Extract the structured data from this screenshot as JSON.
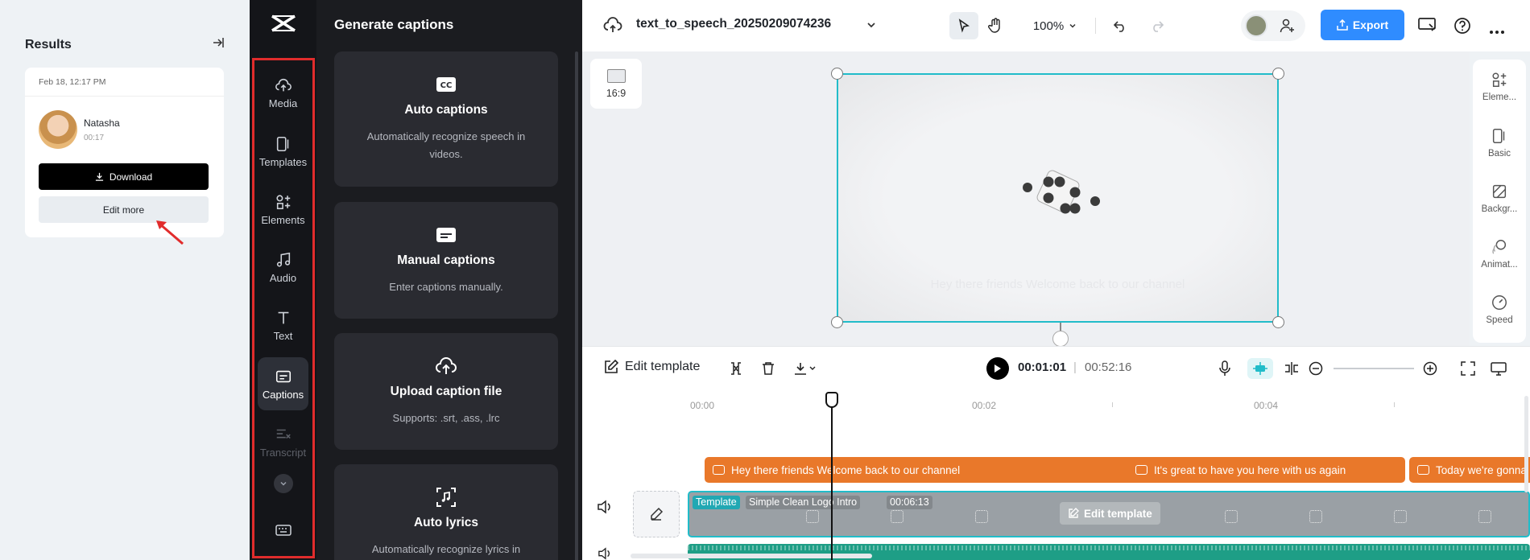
{
  "results": {
    "title": "Results",
    "date": "Feb 18, 12:17 PM",
    "user_name": "Natasha",
    "duration": "00:17",
    "download_label": "Download",
    "edit_more_label": "Edit more"
  },
  "nav": {
    "items": [
      {
        "label": "Media",
        "icon": "cloud-upload-icon"
      },
      {
        "label": "Templates",
        "icon": "templates-icon"
      },
      {
        "label": "Elements",
        "icon": "elements-icon"
      },
      {
        "label": "Audio",
        "icon": "music-note-icon"
      },
      {
        "label": "Text",
        "icon": "text-icon"
      },
      {
        "label": "Captions",
        "icon": "captions-icon",
        "active": true
      },
      {
        "label": "Transcript",
        "icon": "transcript-icon"
      }
    ]
  },
  "captions_panel": {
    "title": "Generate captions",
    "cards": [
      {
        "name": "Auto captions",
        "desc": "Automatically recognize speech in videos.",
        "icon": "cc-icon"
      },
      {
        "name": "Manual captions",
        "desc": "Enter captions manually.",
        "icon": "subtitle-icon"
      },
      {
        "name": "Upload caption file",
        "desc": "Supports: .srt, .ass, .lrc",
        "icon": "cloud-upload-icon"
      },
      {
        "name": "Auto lyrics",
        "desc": "Automatically recognize lyrics in",
        "icon": "lyrics-icon"
      }
    ]
  },
  "topbar": {
    "project_name": "text_to_speech_20250209074236",
    "zoom": "100%",
    "export_label": "Export"
  },
  "canvas": {
    "ratio": "16:9",
    "subtitle_text": "Hey there friends Welcome back to our channel"
  },
  "props": {
    "items": [
      "Eleme...",
      "Basic",
      "Backgr...",
      "Animat...",
      "Speed"
    ]
  },
  "timeline_bar": {
    "edit_template_label": "Edit template",
    "current_time": "00:01:01",
    "separator": "|",
    "total_time": "00:52:16"
  },
  "timeline": {
    "ticks": [
      "00:00",
      "00:02",
      "00:04"
    ],
    "caption_clips": [
      "Hey there friends Welcome back to our channel",
      "It's great to have you here with us again",
      "Today we're gonna"
    ],
    "template_tag": "Template",
    "template_name": "Simple Clean Logo Intro",
    "template_duration": "00:06:13",
    "edit_template_label": "Edit template"
  },
  "colors": {
    "accent": "#2f8cff",
    "selection": "#21bcc9",
    "caption_clip": "#e9782a",
    "audio_track": "#1e9e86",
    "highlight_box": "#e12c2c"
  }
}
